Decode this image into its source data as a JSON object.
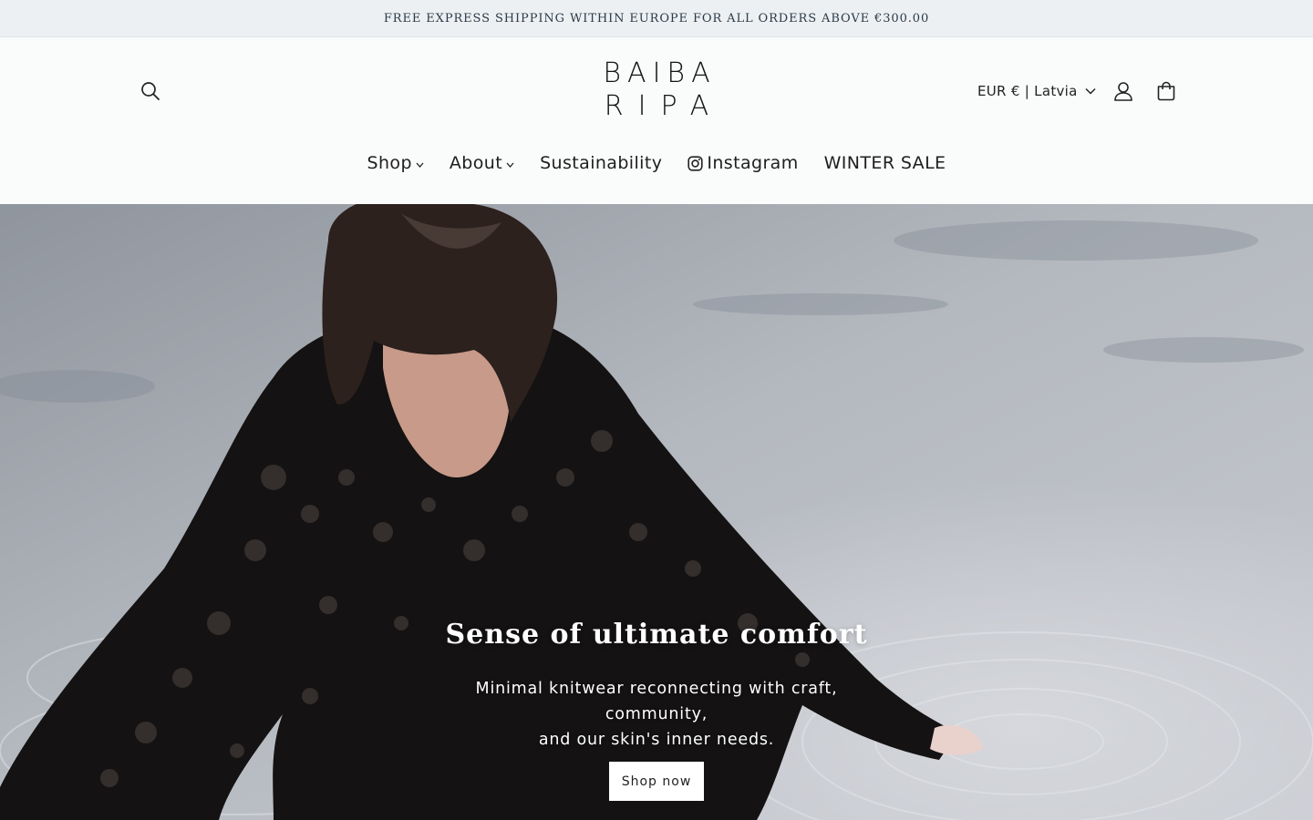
{
  "announcement": {
    "text": "FREE EXPRESS SHIPPING WITHIN EUROPE FOR ALL ORDERS ABOVE €300.00"
  },
  "header": {
    "logo_line1": "BAIBA",
    "logo_line2": "RIPA",
    "locale_label": "EUR € | Latvia",
    "icons": {
      "search": "search-icon",
      "account": "user-icon",
      "cart": "shopping-bag-icon",
      "locale_caret": "chevron-down-icon"
    }
  },
  "nav": {
    "items": [
      {
        "label": "Shop",
        "has_dropdown": true
      },
      {
        "label": "About",
        "has_dropdown": true
      },
      {
        "label": "Sustainability",
        "has_dropdown": false
      },
      {
        "label": "Instagram",
        "has_dropdown": false,
        "icon": "instagram-icon"
      },
      {
        "label": "WINTER SALE",
        "has_dropdown": false
      }
    ]
  },
  "hero": {
    "title": "Sense of ultimate comfort",
    "subtitle_line1": "Minimal knitwear reconnecting with craft, community,",
    "subtitle_line2": "and our skin's inner needs.",
    "cta_label": "Shop now"
  },
  "colors": {
    "announcement_bg": "#edf0f2",
    "page_bg": "#fafbfb",
    "text": "#1f1f1f",
    "cta_bg": "#ffffff"
  }
}
